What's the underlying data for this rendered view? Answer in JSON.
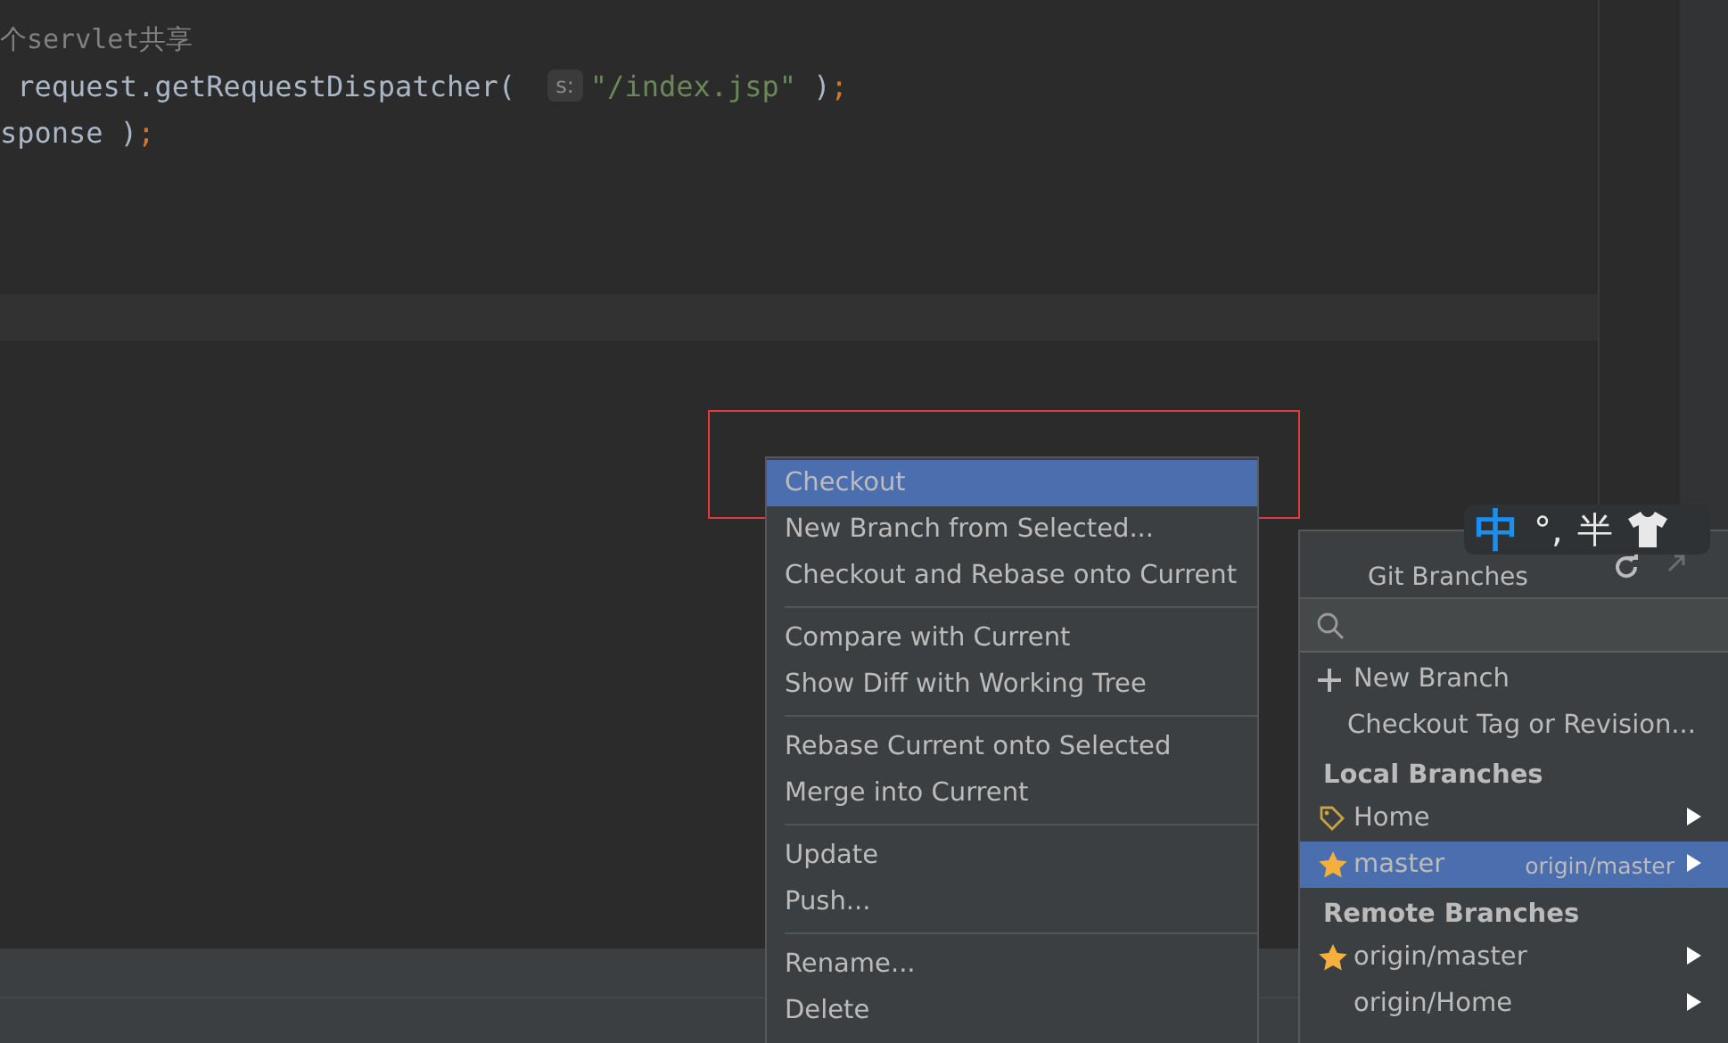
{
  "editor": {
    "lines": [
      {
        "tokens": [
          {
            "kind": "comment",
            "text": "个servlet共享"
          }
        ]
      },
      {
        "tokens": [
          {
            "kind": "plain",
            "text": " request.getRequestDispatcher( "
          },
          {
            "kind": "hint",
            "text": "s:"
          },
          {
            "kind": "string",
            "text": "\"/index.jsp\""
          },
          {
            "kind": "plain",
            "text": " )"
          },
          {
            "kind": "keyword",
            "text": ";"
          }
        ]
      },
      {
        "tokens": [
          {
            "kind": "plain",
            "text": "sponse )"
          },
          {
            "kind": "keyword",
            "text": ";"
          }
        ]
      }
    ]
  },
  "context_menu": {
    "groups": [
      [
        {
          "label": "Checkout",
          "selected": true
        },
        {
          "label": "New Branch from Selected...",
          "selected": false
        },
        {
          "label": "Checkout and Rebase onto Current",
          "selected": false
        }
      ],
      [
        {
          "label": "Compare with Current",
          "selected": false
        },
        {
          "label": "Show Diff with Working Tree",
          "selected": false
        }
      ],
      [
        {
          "label": "Rebase Current onto Selected",
          "selected": false
        },
        {
          "label": "Merge into Current",
          "selected": false
        }
      ],
      [
        {
          "label": "Update",
          "selected": false
        },
        {
          "label": "Push...",
          "selected": false
        }
      ],
      [
        {
          "label": "Rename...",
          "selected": false
        },
        {
          "label": "Delete",
          "selected": false
        }
      ]
    ]
  },
  "git_branches": {
    "title": "Git Branches",
    "actions": [
      {
        "kind": "add",
        "label": "New Branch"
      },
      {
        "kind": "plain",
        "label": "Checkout Tag or Revision..."
      }
    ],
    "sections": [
      {
        "title": "Local Branches",
        "items": [
          {
            "label": "Home",
            "kind": "tag",
            "selected": false
          },
          {
            "label": "master",
            "kind": "star",
            "tracking": "origin/master",
            "selected": true
          }
        ]
      },
      {
        "title": "Remote Branches",
        "items": [
          {
            "label": "origin/master",
            "kind": "star",
            "selected": false
          },
          {
            "label": "origin/Home",
            "kind": "plain",
            "selected": false
          }
        ]
      }
    ]
  },
  "ime_toolbar": {
    "mode": "中",
    "punctuation": "°,",
    "width": "半"
  }
}
